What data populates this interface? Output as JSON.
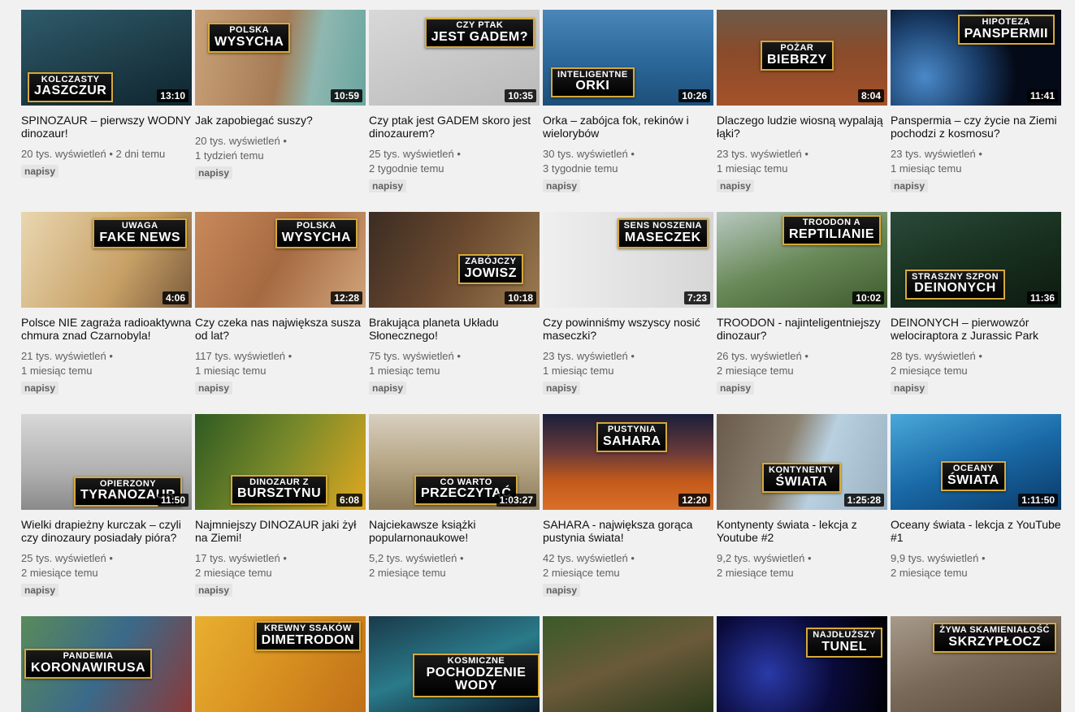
{
  "videos": [
    {
      "thumb_l1": "KOLCZASTY",
      "thumb_l2": "JASZCZUR",
      "duration": "13:10",
      "title": "SPINOZAUR – pierwszy WODNY dinozaur!",
      "views": "20 tys. wyświetleń",
      "age": "2 dni temu",
      "badge": "napisy",
      "bg": "linear-gradient(160deg,#2f5b6b,#1c3a45 60%,#0f2530)",
      "tpos": "left:8px;bottom:4px;"
    },
    {
      "thumb_l1": "POLSKA",
      "thumb_l2": "WYSYCHA",
      "duration": "10:59",
      "title": "Jak zapobiegać suszy?",
      "views": "20 tys. wyświetleń",
      "age": "1 tydzień temu",
      "badge": "napisy",
      "bg": "linear-gradient(100deg,#c9a178,#a57b55 50%,#8fb7b0 70%,#6aa5a0)",
      "tpos": "left:16px;top:16px;"
    },
    {
      "thumb_l1": "CZY PTAK",
      "thumb_l2": "JEST GADEM?",
      "duration": "10:35",
      "title": "Czy ptak jest GADEM skoro jest dinozaurem?",
      "views": "25 tys. wyświetleń",
      "age": "2 tygodnie temu",
      "badge": "napisy",
      "bg": "linear-gradient(160deg,#d8d8d8,#b9b9b9)",
      "tpos": "right:6px;top:10px;"
    },
    {
      "thumb_l1": "INTELIGENTNE",
      "thumb_l2": "ORKI",
      "duration": "10:26",
      "title": "Orka – zabójca fok, rekinów i wielorybów",
      "views": "30 tys. wyświetleń",
      "age": "3 tygodnie temu",
      "badge": "napisy",
      "bg": "linear-gradient(180deg,#4a86b8,#2d6a9c 50%,#1d4f7a)",
      "tpos": "left:10px;bottom:10px;"
    },
    {
      "thumb_l1": "POŻAR",
      "thumb_l2": "BIEBRZY",
      "duration": "8:04",
      "title": "Dlaczego ludzie wiosną wypalają łąki?",
      "views": "23 tys. wyświetleń",
      "age": "1 miesiąc temu",
      "badge": "napisy",
      "bg": "linear-gradient(180deg,#6c5a4a,#8a4b2a 45%,#a4522a)",
      "tpos": "left:54px;top:38px;"
    },
    {
      "thumb_l1": "HIPOTEZA",
      "thumb_l2": "PANSPERMII",
      "duration": "11:41",
      "title": "Panspermia – czy życie na Ziemi pochodzi z kosmosu?",
      "views": "23 tys. wyświetleń",
      "age": "1 miesiąc temu",
      "badge": "napisy",
      "bg": "radial-gradient(circle at 20% 70%,#4a89c8,#1b3f6b 35%,#050a18 60%)",
      "tpos": "right:8px;top:6px;"
    },
    {
      "thumb_l1": "UWAGA",
      "thumb_l2": "FAKE NEWS",
      "duration": "4:06",
      "title": "Polsce NIE zagraża radioaktywna chmura znad Czarnobyla!",
      "views": "21 tys. wyświetleń",
      "age": "1 miesiąc temu",
      "badge": "napisy",
      "bg": "linear-gradient(120deg,#e9d7b0,#c7a066 60%,#7b5b3c)",
      "tpos": "right:6px;top:8px;"
    },
    {
      "thumb_l1": "POLSKA",
      "thumb_l2": "WYSYCHA",
      "duration": "12:28",
      "title": "Czy czeka nas największa susza od lat?",
      "views": "117 tys. wyświetleń",
      "age": "1 miesiąc temu",
      "badge": "napisy",
      "bg": "linear-gradient(120deg,#c88a5a,#a66a42 50%,#d0a47a)",
      "tpos": "right:10px;top:8px;"
    },
    {
      "thumb_l1": "ZABÓJCZY",
      "thumb_l2": "JOWISZ",
      "duration": "10:18",
      "title": "Brakująca planeta Układu Słonecznego!",
      "views": "75 tys. wyświetleń",
      "age": "1 miesiąc temu",
      "badge": "napisy",
      "bg": "linear-gradient(120deg,#3b2c22,#6b4a30 50%,#9b7a50)",
      "tpos": "right:20px;top:52px;"
    },
    {
      "thumb_l1": "SENS NOSZENIA",
      "thumb_l2": "MASECZEK",
      "duration": "7:23",
      "title": "Czy powinniśmy wszyscy nosić maseczki?",
      "views": "23 tys. wyświetleń",
      "age": "1 miesiąc temu",
      "badge": "napisy",
      "bg": "linear-gradient(90deg,#efefef,#d6d6d6)",
      "tpos": "right:6px;top:8px;"
    },
    {
      "thumb_l1": "TROODON A",
      "thumb_l2": "REPTILIANIE",
      "duration": "10:02",
      "title": "TROODON - najinteligentniejszy dinozaur?",
      "views": "26 tys. wyświetleń",
      "age": "2 miesiące temu",
      "badge": "napisy",
      "bg": "linear-gradient(160deg,#b8c8c0,#6a8a5a 50%,#3e5a2c)",
      "tpos": "right:8px;top:4px;"
    },
    {
      "thumb_l1": "STRASZNY SZPON",
      "thumb_l2": "DEINONYCH",
      "duration": "11:36",
      "title": "DEINONYCH – pierwowzór welociraptora z Jurassic Park",
      "views": "28 tys. wyświetleń",
      "age": "2 miesiące temu",
      "badge": "napisy",
      "bg": "linear-gradient(160deg,#2a4a3a,#18301f 50%,#0d1a10)",
      "tpos": "left:18px;bottom:10px;"
    },
    {
      "thumb_l1": "OPIERZONY",
      "thumb_l2": "TYRANOZAUR",
      "duration": "11:50",
      "title": "Wielki drapieżny kurczak – czyli czy dinozaury posiadały pióra?",
      "views": "25 tys. wyświetleń",
      "age": "2 miesiące temu",
      "badge": "napisy",
      "bg": "linear-gradient(180deg,#d8d8d8,#b0b0b0 60%,#8a8a8a)",
      "tpos": "right:12px;bottom:4px;"
    },
    {
      "thumb_l1": "DINOZAUR Z",
      "thumb_l2": "BURSZTYNU",
      "duration": "6:08",
      "title": "Najmniejszy DINOZAUR jaki żył na Ziemi!",
      "views": "17 tys. wyświetleń",
      "age": "2 miesiące temu",
      "badge": "napisy",
      "bg": "linear-gradient(120deg,#2e5a22,#7a8a2a 50%,#e0a820)",
      "tpos": "left:44px;bottom:6px;"
    },
    {
      "thumb_l1": "CO WARTO",
      "thumb_l2": "PRZECZYTAĆ",
      "duration": "1:03:27",
      "title": "Najciekawsze książki popularnonaukowe!",
      "views": "5,2 tys. wyświetleń",
      "age": "2 miesiące temu",
      "badge": "",
      "bg": "linear-gradient(180deg,#d8cfbf,#b8a888 50%,#8a7a5a)",
      "tpos": "left:56px;bottom:6px;"
    },
    {
      "thumb_l1": "PUSTYNIA",
      "thumb_l2": "SAHARA",
      "duration": "12:20",
      "title": "SAHARA - największa gorąca pustynia świata!",
      "views": "42 tys. wyświetleń",
      "age": "2 miesiące temu",
      "badge": "napisy",
      "bg": "linear-gradient(180deg,#1a1f3a,#6a3a3a 40%,#c45a1a 70%,#d8702a)",
      "tpos": "left:66px;top:10px;"
    },
    {
      "thumb_l1": "KONTYNENTY",
      "thumb_l2": "ŚWIATA",
      "duration": "1:25:28",
      "title": "Kontynenty świata - lekcja z Youtube #2",
      "views": "9,2 tys. wyświetleń",
      "age": "2 miesiące temu",
      "badge": "",
      "bg": "linear-gradient(110deg,#6a5a4a,#8a8070 40%,#b8d0e0 60%,#9ab0c0)",
      "tpos": "left:56px;top:60px;"
    },
    {
      "thumb_l1": "OCEANY",
      "thumb_l2": "ŚWIATA",
      "duration": "1:11:50",
      "title": "Oceany świata - lekcja z YouTube #1",
      "views": "9,9 tys. wyświetleń",
      "age": "2 miesiące temu",
      "badge": "",
      "bg": "linear-gradient(160deg,#4aa8d8,#1a6aa8 50%,#0a3a68)",
      "tpos": "left:62px;top:58px;"
    },
    {
      "thumb_l1": "PANDEMIA",
      "thumb_l2": "KORONAWIRUSA",
      "duration": "",
      "title": "",
      "views": "",
      "age": "",
      "badge": "",
      "bg": "linear-gradient(120deg,#5a8a5a,#3a6a8a 50%,#8a3a3a)",
      "tpos": "left:4px;top:40px;"
    },
    {
      "thumb_l1": "KREWNY SSAKÓW",
      "thumb_l2": "DIMETRODON",
      "duration": "",
      "title": "",
      "views": "",
      "age": "",
      "badge": "",
      "bg": "linear-gradient(120deg,#e8b030,#d89020 50%,#c07018)",
      "tpos": "right:6px;top:6px;"
    },
    {
      "thumb_l1": "KOSMICZNE",
      "thumb_l2": "POCHODZENIE WODY",
      "duration": "",
      "title": "",
      "views": "",
      "age": "",
      "badge": "",
      "bg": "linear-gradient(160deg,#1a3a4a,#2a7a8a 50%,#0a1a2a)",
      "tpos": "left:54px;top:46px;"
    },
    {
      "thumb_l1": "",
      "thumb_l2": "",
      "duration": "",
      "title": "",
      "views": "",
      "age": "",
      "badge": "",
      "bg": "linear-gradient(160deg,#3a5a2a,#6a5a3a 50%,#2a3a1a)",
      "tpos": "display:none;"
    },
    {
      "thumb_l1": "NAJDŁUŻSZY",
      "thumb_l2": "TUNEL",
      "duration": "",
      "title": "",
      "views": "",
      "age": "",
      "badge": "",
      "bg": "radial-gradient(circle at 30% 60%,#2a3aa8,#0a0a3a 50%,#000)",
      "tpos": "right:6px;top:14px;"
    },
    {
      "thumb_l1": "ŻYWA SKAMIENIAŁOŚĆ",
      "thumb_l2": "SKRZYPŁOCZ",
      "duration": "",
      "title": "",
      "views": "",
      "age": "",
      "badge": "",
      "bg": "linear-gradient(160deg,#a89a8a,#7a6a5a 50%,#5a4a3a)",
      "tpos": "right:6px;top:8px;"
    }
  ]
}
